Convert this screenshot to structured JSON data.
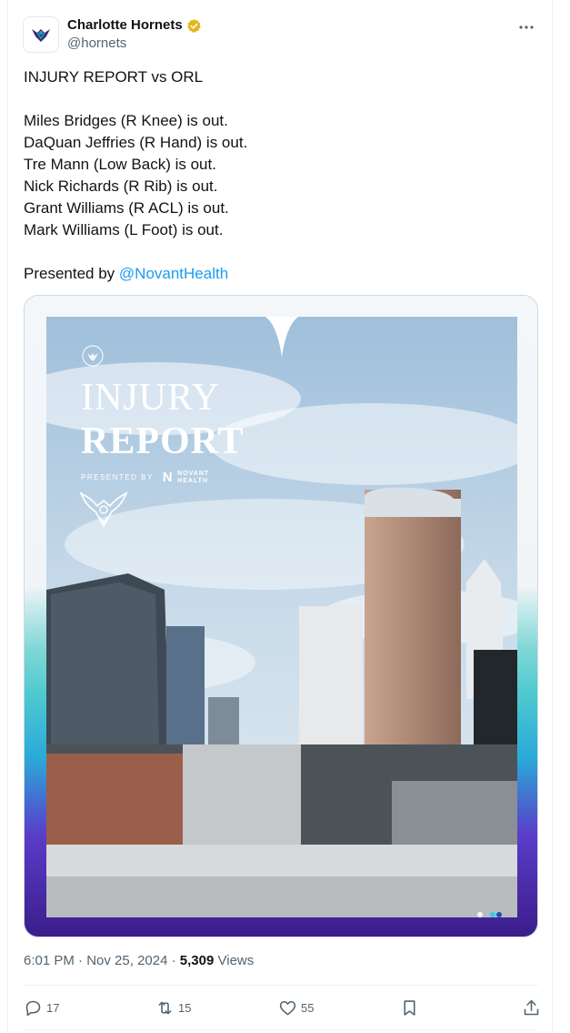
{
  "author": {
    "display_name": "Charlotte Hornets",
    "handle": "@hornets",
    "verified": true,
    "avatar_icon": "hornets-logo-icon"
  },
  "tweet": {
    "lines": [
      "INJURY REPORT vs ORL",
      "",
      "Miles Bridges (R Knee) is out.",
      "DaQuan Jeffries (R Hand) is out.",
      "Tre Mann (Low Back) is out.",
      "Nick Richards (R Rib) is out.",
      "Grant Williams (R ACL) is out.",
      "Mark Williams (L Foot) is out.",
      ""
    ],
    "presented_prefix": "Presented by ",
    "presented_mention": "@NovantHealth"
  },
  "media": {
    "title_line1": "INJURY",
    "title_line2": "REPORT",
    "presented_label": "PRESENTED BY",
    "sponsor_mark": "N",
    "sponsor_line1": "NOVANT",
    "sponsor_line2": "HEALTH",
    "carousel_total": 2,
    "carousel_active": 2
  },
  "meta": {
    "time": "6:01 PM",
    "separator": " · ",
    "date": "Nov 25, 2024",
    "views_count": "5,309",
    "views_label": " Views"
  },
  "actions": {
    "replies": "17",
    "reposts": "15",
    "likes": "55"
  },
  "colors": {
    "accent": "#1d9bf0",
    "verified_gold": "#e2b719",
    "muted": "#536471",
    "text": "#0f1419"
  }
}
